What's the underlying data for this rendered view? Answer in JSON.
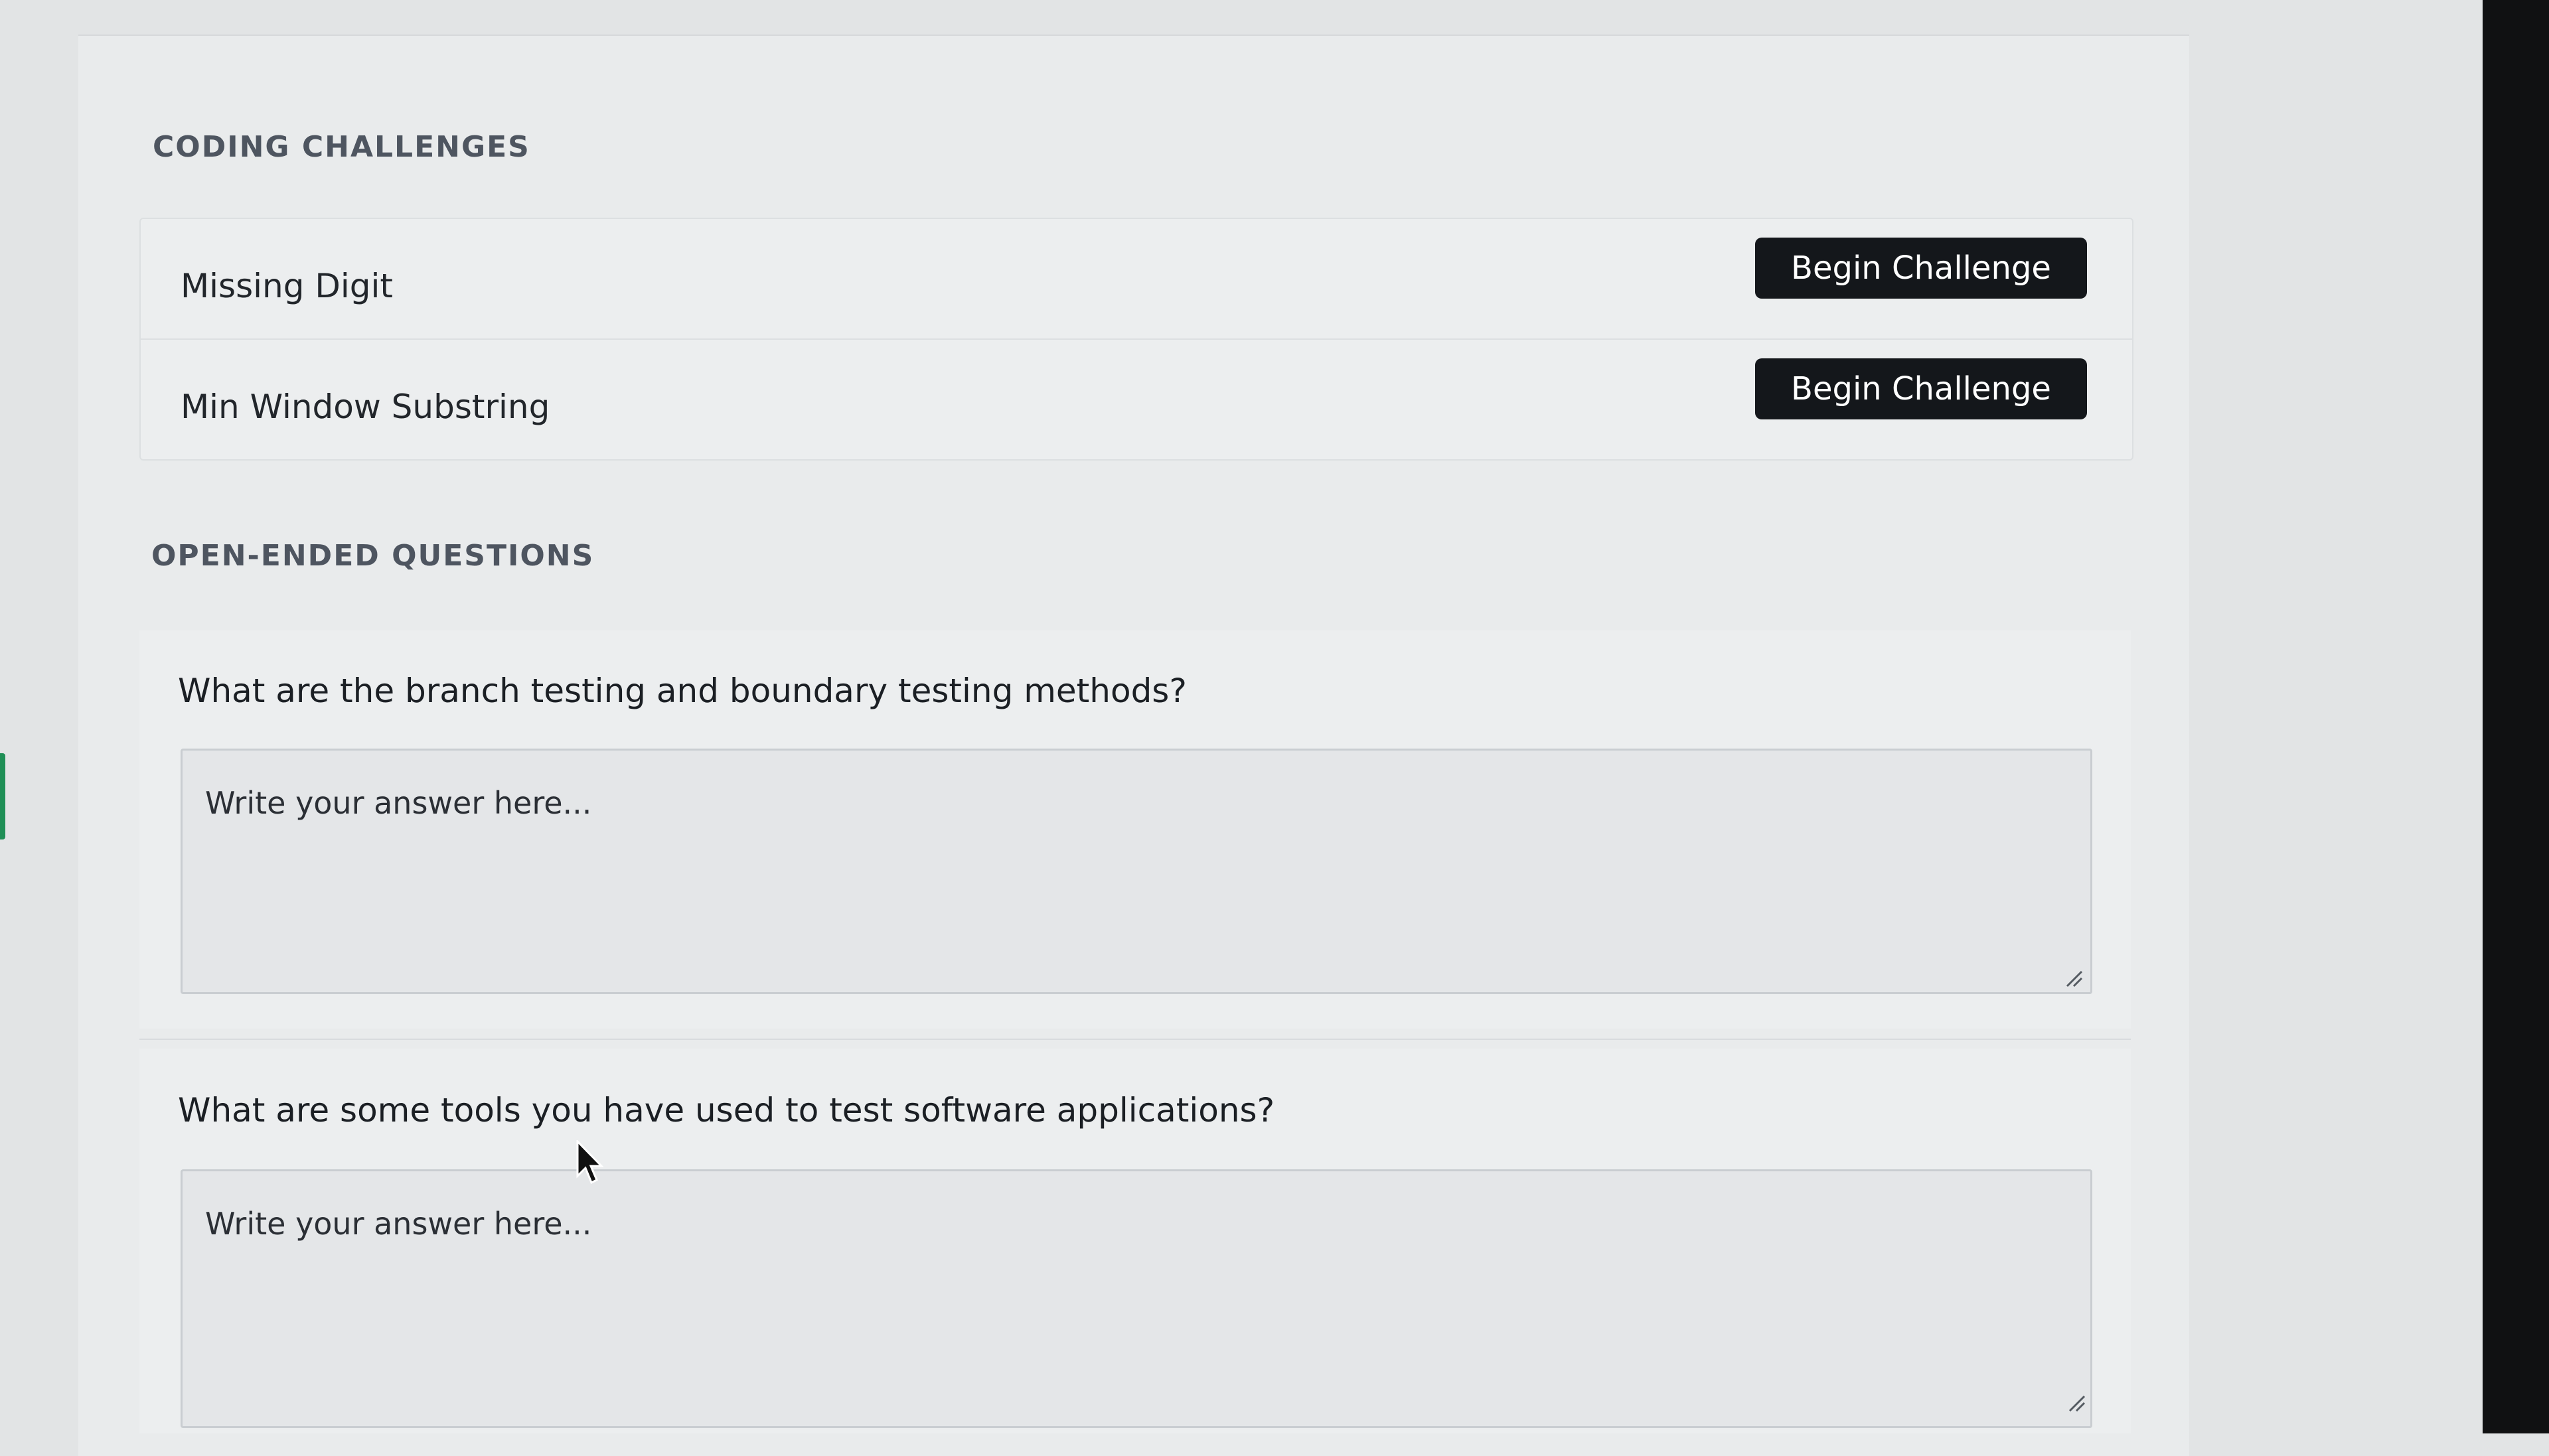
{
  "coding_challenges": {
    "heading": "CODING CHALLENGES",
    "items": [
      {
        "name": "Missing Digit",
        "button_label": "Begin Challenge"
      },
      {
        "name": "Min Window Substring",
        "button_label": "Begin Challenge"
      }
    ]
  },
  "open_ended_questions": {
    "heading": "OPEN-ENDED QUESTIONS",
    "questions": [
      {
        "text": "What are the branch testing and boundary testing methods?",
        "answer_placeholder": "Write your answer here...",
        "answer_value": ""
      },
      {
        "text": "What are some tools you have used to test software applications?",
        "answer_placeholder": "Write your answer here...",
        "answer_value": ""
      }
    ]
  },
  "colors": {
    "button_background": "#14171b",
    "button_text": "#ffffff",
    "heading_text": "#4e5560"
  }
}
